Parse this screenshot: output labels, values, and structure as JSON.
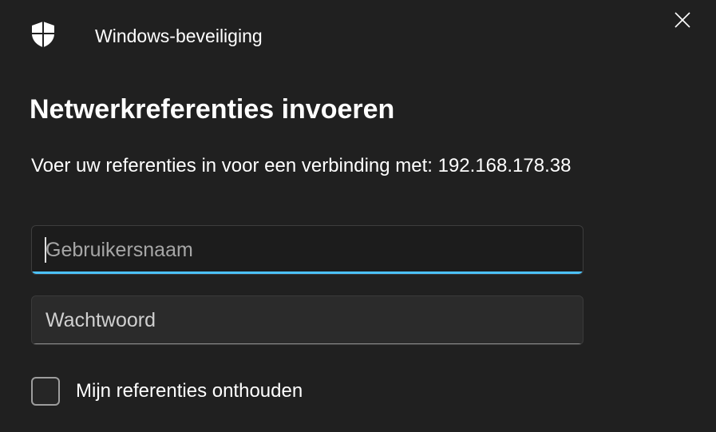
{
  "window": {
    "app_title": "Windows-beveiliging",
    "app_icon": "shield-icon",
    "close_icon": "close-icon"
  },
  "main": {
    "heading": "Netwerkreferenties invoeren",
    "prompt": "Voer uw referenties in voor een verbinding met: 192.168.178.38"
  },
  "form": {
    "username": {
      "value": "",
      "placeholder": "Gebruikersnaam",
      "focused": true
    },
    "password": {
      "value": "",
      "placeholder": "Wachtwoord"
    },
    "remember": {
      "label": "Mijn referenties onthouden",
      "checked": false
    }
  },
  "colors": {
    "background": "#202020",
    "focus_accent": "#4cc2ff",
    "text": "#ffffff"
  }
}
